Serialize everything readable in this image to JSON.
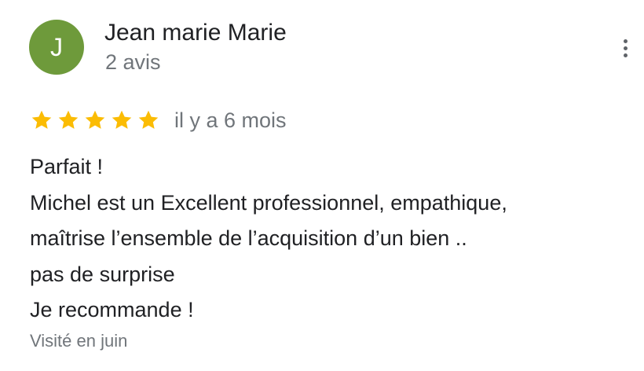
{
  "author": {
    "initial": "J",
    "name": "Jean marie Marie",
    "review_count": "2 avis",
    "avatar_color": "#6e9a3b"
  },
  "menu": {
    "icon": "more-vert-icon"
  },
  "rating": {
    "stars": 5,
    "max_stars": 5,
    "star_color": "#fbbc04",
    "relative_time": "il y a 6 mois"
  },
  "review": {
    "lines": [
      "Parfait !",
      "Michel est un Excellent professionnel, empathique,",
      "maîtrise l’ensemble de l’acquisition d’un bien ..",
      "pas de surprise",
      "Je recommande !"
    ]
  },
  "visit": {
    "label": "Visité en juin"
  }
}
